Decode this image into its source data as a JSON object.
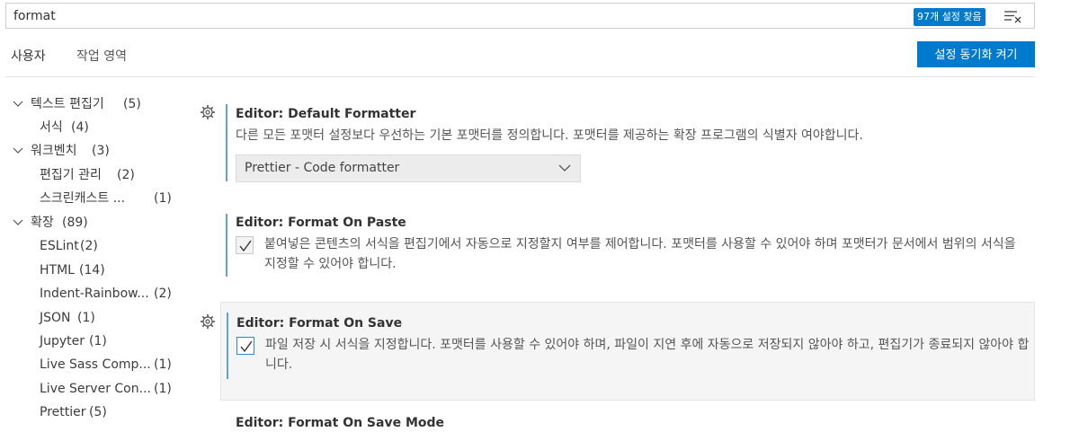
{
  "search": {
    "value": "format",
    "result_count": "97개 설정 찾음",
    "clear_icon": "clear-filter-icon"
  },
  "tabs": [
    {
      "label": "사용자",
      "active": true
    },
    {
      "label": "작업 영역",
      "active": false
    }
  ],
  "sync_button": "설정 동기화 켜기",
  "toc": [
    {
      "label": "텍스트 편집기",
      "count": "(5)",
      "expanded": true,
      "level": 0
    },
    {
      "label": "서식",
      "count": "(4)",
      "level": 1
    },
    {
      "label": "워크벤치",
      "count": "(3)",
      "expanded": true,
      "level": 0
    },
    {
      "label": "편집기 관리",
      "count": "(2)",
      "level": 1
    },
    {
      "label": "스크린캐스트 ...",
      "count": "(1)",
      "level": 1
    },
    {
      "label": "확장",
      "count": "(89)",
      "expanded": true,
      "level": 0
    },
    {
      "label": "ESLint",
      "count": "(2)",
      "level": 1
    },
    {
      "label": "HTML",
      "count": "(14)",
      "level": 1
    },
    {
      "label": "Indent-Rainbow...",
      "count": "(2)",
      "level": 1
    },
    {
      "label": "JSON",
      "count": "(1)",
      "level": 1
    },
    {
      "label": "Jupyter",
      "count": "(1)",
      "level": 1
    },
    {
      "label": "Live Sass Comp...",
      "count": "(1)",
      "level": 1
    },
    {
      "label": "Live Server Con...",
      "count": "(1)",
      "level": 1
    },
    {
      "label": "Prettier",
      "count": "(5)",
      "level": 1
    }
  ],
  "settings": {
    "default_formatter": {
      "title": "Editor: Default Formatter",
      "description": "다른 모든 포맷터 설정보다 우선하는 기본 포맷터를 정의합니다. 포맷터를 제공하는 확장 프로그램의 식별자 여야합니다.",
      "value": "Prettier - Code formatter"
    },
    "format_on_paste": {
      "title": "Editor: Format On Paste",
      "description": "붙여넣은 콘텐츠의 서식을 편집기에서 자동으로 지정할지 여부를 제어합니다. 포맷터를 사용할 수 있어야 하며 포맷터가 문서에서 범위의 서식을 지정할 수 있어야 합니다.",
      "checked": true
    },
    "format_on_save": {
      "title": "Editor: Format On Save",
      "description": "파일 저장 시 서식을 지정합니다. 포맷터를 사용할 수 있어야 하며, 파일이 지연 후에 자동으로 저장되지 않아야 하고, 편집기가 종료되지 않아야 합니다.",
      "checked": true
    },
    "format_on_save_mode": {
      "title": "Editor: Format On Save Mode"
    }
  },
  "colors": {
    "accent": "#007acc",
    "modified_indicator": "#5fa2d9"
  }
}
